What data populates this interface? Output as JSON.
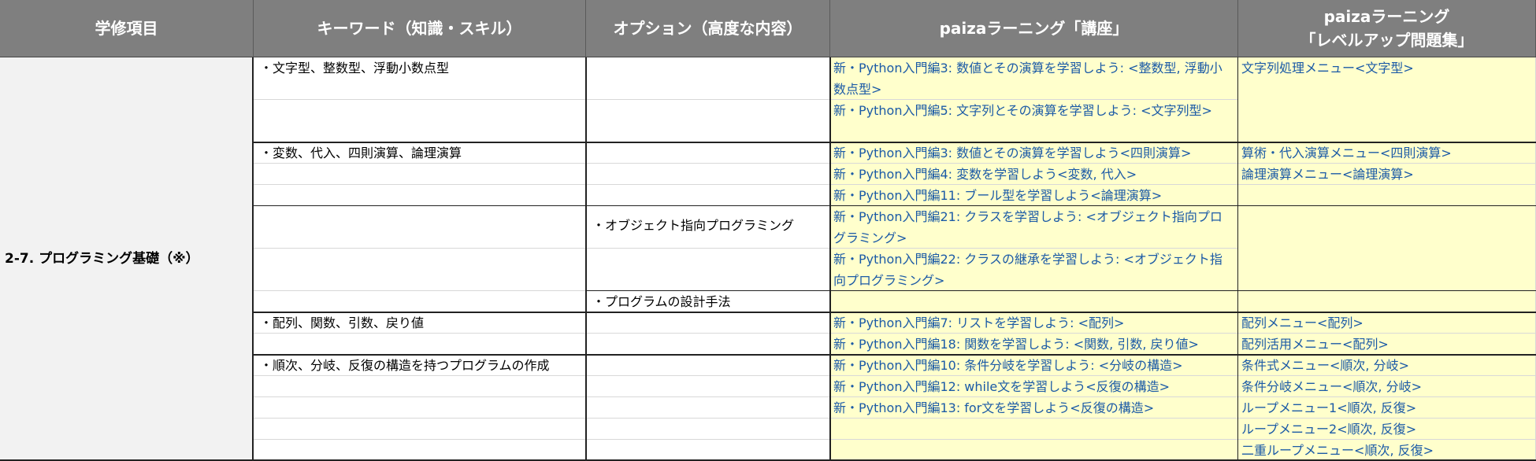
{
  "headers": {
    "col1": "学修項目",
    "col2": "キーワード（知識・スキル）",
    "col3": "オプション（高度な内容）",
    "col4": "paizaラーニング「講座」",
    "col5_line1": "paizaラーニング",
    "col5_line2": "「レベルアップ問題集」"
  },
  "category": "2-7. プログラミング基礎（※）",
  "keywords": [
    "・文字型、整数型、浮動小数点型",
    "・変数、代入、四則演算、論理演算",
    "・配列、関数、引数、戻り値",
    "・順次、分岐、反復の構造を持つプログラムの作成"
  ],
  "options": [
    "・オブジェクト指向プログラミング",
    "・プログラムの設計手法"
  ],
  "courses": [
    "新・Python入門編3: 数値とその演算を学習しよう: <整数型, 浮動小数点型>",
    "新・Python入門編5: 文字列とその演算を学習しよう: <文字列型>",
    "新・Python入門編3: 数値とその演算を学習しよう<四則演算>",
    "新・Python入門編4: 変数を学習しよう<変数, 代入>",
    "新・Python入門編11: ブール型を学習しよう<論理演算>",
    "新・Python入門編21: クラスを学習しよう: <オブジェクト指向プログラミング>",
    "新・Python入門編22: クラスの継承を学習しよう: <オブジェクト指向プログラミング>",
    "新・Python入門編7: リストを学習しよう: <配列>",
    "新・Python入門編18: 関数を学習しよう: <関数, 引数, 戻り値>",
    "新・Python入門編10: 条件分岐を学習しよう: <分岐の構造>",
    "新・Python入門編12: while文を学習しよう<反復の構造>",
    "新・Python入門編13: for文を学習しよう<反復の構造>"
  ],
  "levelup": [
    "文字列処理メニュー<文字型>",
    "算術・代入演算メニュー<四則演算>",
    "論理演算メニュー<論理演算>",
    "配列メニュー<配列>",
    "配列活用メニュー<配列>",
    "条件式メニュー<順次, 分岐>",
    "条件分岐メニュー<順次, 分岐>",
    "ループメニュー1<順次, 反復>",
    "ループメニュー2<順次, 反復>",
    "二重ループメニュー<順次, 反復>"
  ]
}
